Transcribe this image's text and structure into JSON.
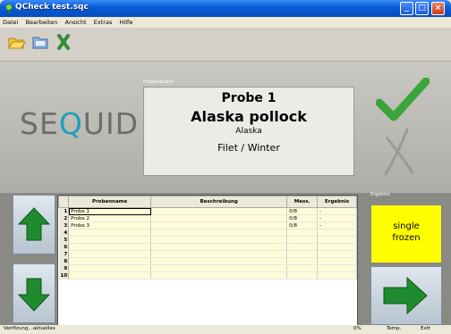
{
  "window": {
    "title": "QCheck test.sqc"
  },
  "menu": [
    "Datei",
    "Bearbeiten",
    "Ansicht",
    "Extras",
    "Hilfe"
  ],
  "toolbar": {
    "buttons": [
      "folder-open-icon",
      "folder-icon",
      "ribbon-icon"
    ]
  },
  "logo": {
    "text_pre": "SE",
    "text_q": "Q",
    "text_post": "UID"
  },
  "probendetails": {
    "label": "Probendetails",
    "probe_name": "Probe 1",
    "species": "Alaska pollock",
    "region": "Alaska",
    "processing": "Filet / Winter"
  },
  "ergebnis": {
    "label": "Ergebnis",
    "line1": "single",
    "line2": "frozen",
    "bg_color": "#ffff00"
  },
  "table": {
    "headers": [
      "Probenname",
      "Beschreibung",
      "Mess.",
      "Ergebnis"
    ],
    "rows": [
      {
        "n": "1",
        "name": "Probe 1",
        "desc": "",
        "mess": "0/8",
        "erg": "-"
      },
      {
        "n": "2",
        "name": "Probe 2",
        "desc": "",
        "mess": "0/8",
        "erg": "-"
      },
      {
        "n": "3",
        "name": "Probe 3",
        "desc": "",
        "mess": "0/8",
        "erg": "-"
      },
      {
        "n": "4",
        "name": "",
        "desc": "",
        "mess": "",
        "erg": ""
      },
      {
        "n": "5",
        "name": "",
        "desc": "",
        "mess": "",
        "erg": ""
      },
      {
        "n": "6",
        "name": "",
        "desc": "",
        "mess": "",
        "erg": ""
      },
      {
        "n": "7",
        "name": "",
        "desc": "",
        "mess": "",
        "erg": ""
      },
      {
        "n": "8",
        "name": "",
        "desc": "",
        "mess": "",
        "erg": ""
      },
      {
        "n": "9",
        "name": "",
        "desc": "",
        "mess": "",
        "erg": ""
      },
      {
        "n": "10",
        "name": "",
        "desc": "",
        "mess": "",
        "erg": ""
      }
    ]
  },
  "status": {
    "left": "Verifizung…aktuelles",
    "right1": "0%",
    "right2": "Temp.",
    "right3": "Extt"
  },
  "colors": {
    "accent_green": "#3aa53a",
    "arrow_green": "#1f8a2e"
  }
}
